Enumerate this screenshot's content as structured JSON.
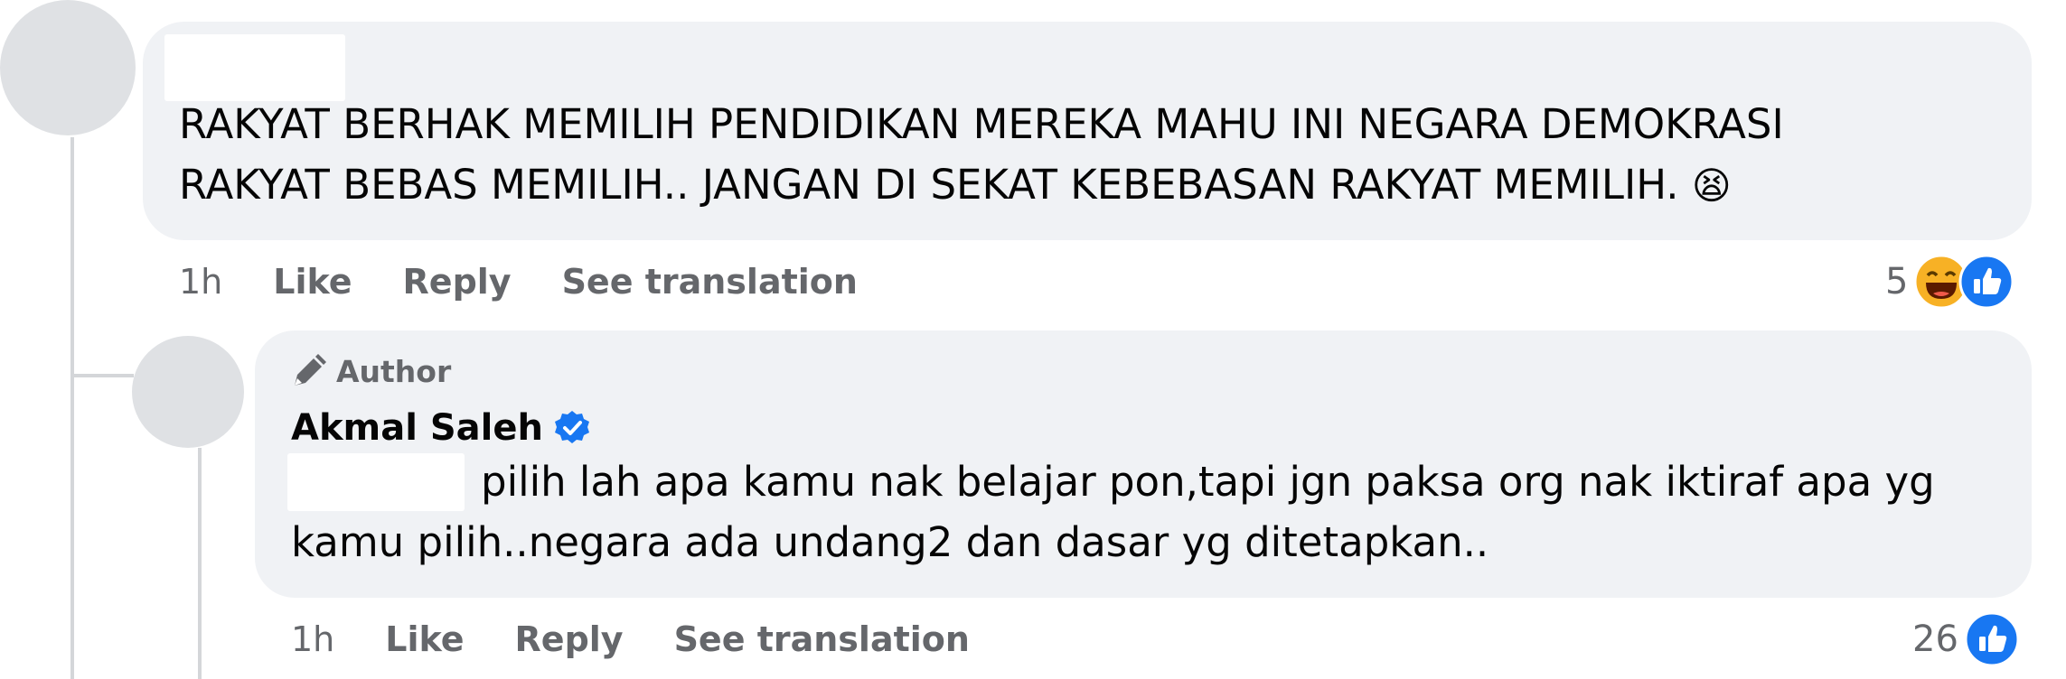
{
  "comment1": {
    "text_line1": "RAKYAT BERHAK MEMILIH PENDIDIKAN MEREKA MAHU INI NEGARA DEMOKRASI",
    "text_line2": "RAKYAT BEBAS MEMILIH.. JANGAN DI SEKAT KEBEBASAN RAKYAT MEMILIH.",
    "emoji": "😫",
    "timestamp": "1h",
    "like_label": "Like",
    "reply_label": "Reply",
    "translate_label": "See translation",
    "reaction_count": "5",
    "reaction_icons": [
      "haha-icon",
      "like-icon"
    ]
  },
  "reply1": {
    "author_badge": "Author",
    "author_name": "Akmal Saleh",
    "verified": true,
    "text_line1": "pilih lah apa kamu nak belajar pon,tapi jgn paksa org nak iktiraf apa yg",
    "text_line2": "kamu pilih..negara ada undang2 dan dasar yg ditetapkan..",
    "timestamp": "1h",
    "like_label": "Like",
    "reply_label": "Reply",
    "translate_label": "See translation",
    "reaction_count": "26",
    "reaction_icons": [
      "like-icon"
    ]
  },
  "colors": {
    "bubble": "#f0f2f5",
    "meta_text": "#65676b",
    "like_blue": "#1877f2",
    "verified_blue": "#1877f2"
  }
}
